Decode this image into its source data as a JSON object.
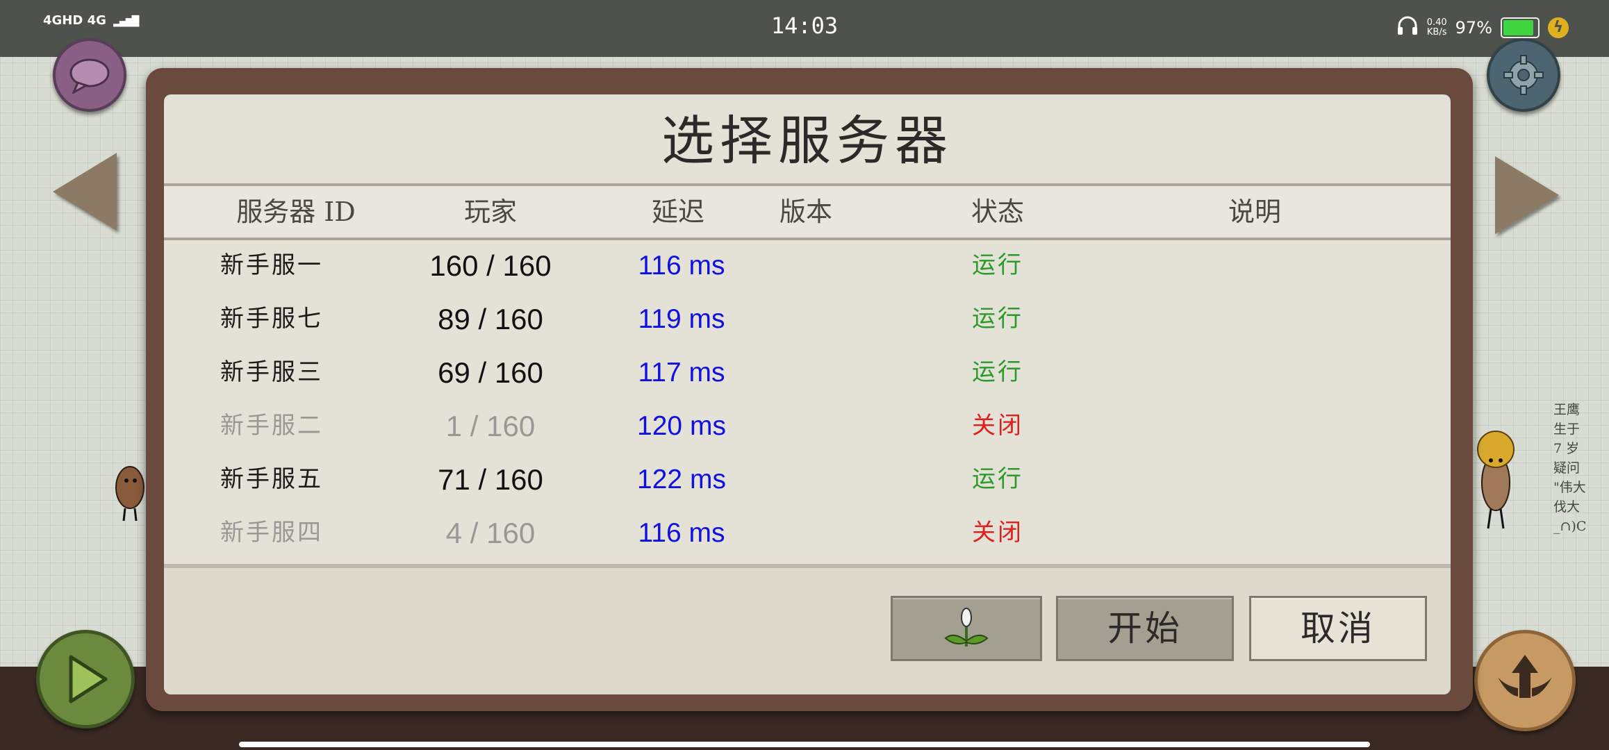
{
  "status_bar": {
    "network": "4GHD 4G",
    "time": "14:03",
    "net_speed_value": "0.40",
    "net_speed_unit": "KB/s",
    "battery": "97%",
    "battery_level": 0.97,
    "colors": {
      "background": "#4e524d",
      "battery_fill": "#3fd53f"
    }
  },
  "dialog": {
    "title": "选择服务器",
    "columns": [
      "服务器 ID",
      "玩家",
      "延迟",
      "版本",
      "状态",
      "说明"
    ],
    "servers": [
      {
        "name": "新手服一",
        "players": "160 / 160",
        "ping": "116 ms",
        "version": "",
        "status": "运行",
        "note": "",
        "online": true
      },
      {
        "name": "新手服七",
        "players": "89 / 160",
        "ping": "119 ms",
        "version": "",
        "status": "运行",
        "note": "",
        "online": true
      },
      {
        "name": "新手服三",
        "players": "69 / 160",
        "ping": "117 ms",
        "version": "",
        "status": "运行",
        "note": "",
        "online": true
      },
      {
        "name": "新手服二",
        "players": "1 / 160",
        "ping": "120 ms",
        "version": "",
        "status": "关闭",
        "note": "",
        "online": false
      },
      {
        "name": "新手服五",
        "players": "71 / 160",
        "ping": "122 ms",
        "version": "",
        "status": "运行",
        "note": "",
        "online": true
      },
      {
        "name": "新手服四",
        "players": "4 / 160",
        "ping": "116 ms",
        "version": "",
        "status": "关闭",
        "note": "",
        "online": false
      }
    ],
    "buttons": {
      "mods_icon": "sprout-icon",
      "start": "开始",
      "cancel": "取消"
    },
    "colors": {
      "running": "#2a9a2a",
      "closed": "#e02020",
      "ping": "#1010e0"
    }
  },
  "background": {
    "side_note_lines": [
      "王鹰",
      "生于",
      "7 岁",
      "疑问",
      "\"伟大",
      "伐大",
      "_∩)C"
    ],
    "icons": [
      "chat-bubble-icon",
      "gear-icon",
      "left-arrow-icon",
      "right-arrow-icon",
      "play-icon",
      "winged-up-arrow-icon"
    ]
  }
}
